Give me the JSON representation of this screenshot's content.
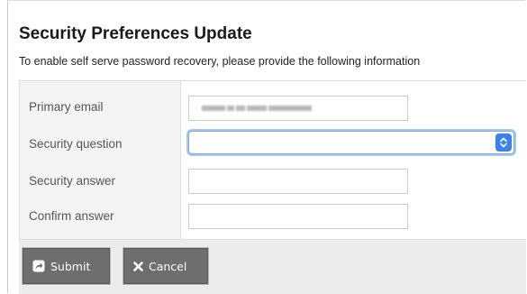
{
  "header": {
    "title": "Security Preferences Update",
    "subtitle": "To enable self serve password recovery, please provide the following information"
  },
  "form": {
    "fields": [
      {
        "label": "Primary email",
        "value": "••••• • •••••••••",
        "type": "text",
        "value_obscured": true
      },
      {
        "label": "Security question",
        "value": "",
        "type": "select",
        "focused": true
      },
      {
        "label": "Security answer",
        "value": "",
        "type": "text"
      },
      {
        "label": "Confirm answer",
        "value": "",
        "type": "text"
      }
    ]
  },
  "buttons": {
    "submit": {
      "label": "Submit",
      "icon": "share-square-icon"
    },
    "cancel": {
      "label": "Cancel",
      "icon": "x-icon"
    }
  },
  "colors": {
    "button_bg": "#6e6e6e",
    "focus_ring": "#a9c8f0",
    "select_arrow_bg": "#3b82f0",
    "label_column_bg": "#f4f4f4",
    "footer_bg": "#ececec"
  }
}
